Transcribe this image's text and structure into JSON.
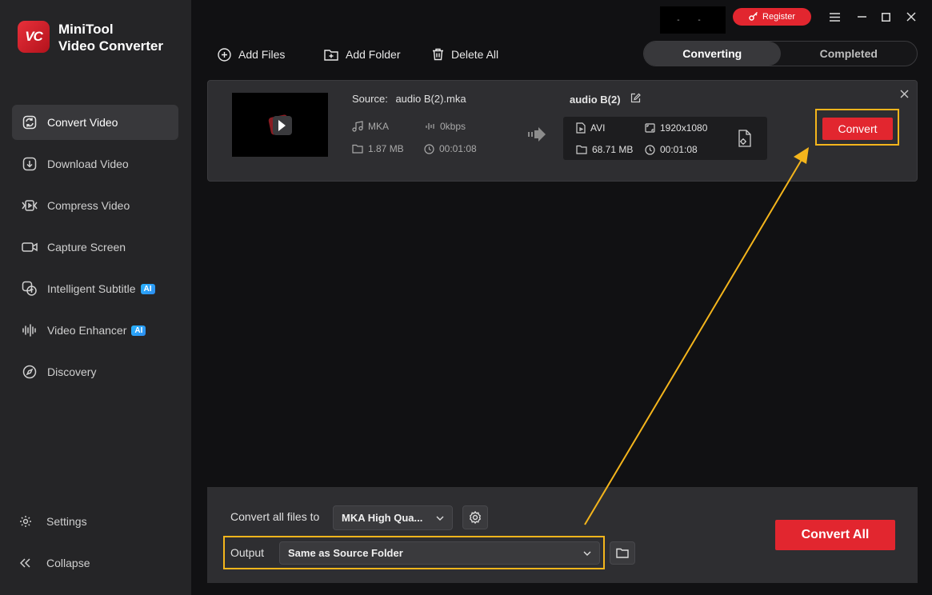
{
  "app": {
    "logo_text": "VC",
    "name_line1": "MiniTool",
    "name_line2": "Video Converter"
  },
  "sidebar": {
    "items": [
      {
        "label": "Convert Video",
        "icon": "convert-icon",
        "active": true,
        "ai": false
      },
      {
        "label": "Download Video",
        "icon": "download-icon",
        "active": false,
        "ai": false
      },
      {
        "label": "Compress Video",
        "icon": "compress-icon",
        "active": false,
        "ai": false
      },
      {
        "label": "Capture Screen",
        "icon": "camera-icon",
        "active": false,
        "ai": false
      },
      {
        "label": "Intelligent Subtitle",
        "icon": "subtitle-icon",
        "active": false,
        "ai": true
      },
      {
        "label": "Video Enhancer",
        "icon": "waveform-icon",
        "active": false,
        "ai": true
      },
      {
        "label": "Discovery",
        "icon": "compass-icon",
        "active": false,
        "ai": false
      }
    ],
    "ai_badge": "AI",
    "settings_label": "Settings",
    "collapse_label": "Collapse"
  },
  "titlebar": {
    "blank_text": "- -",
    "register_label": "Register"
  },
  "toolbar": {
    "add_files": "Add Files",
    "add_folder": "Add Folder",
    "delete_all": "Delete All"
  },
  "tabs": {
    "converting": "Converting",
    "completed": "Completed"
  },
  "task": {
    "source_label": "Source:",
    "source_name": "audio B(2).mka",
    "source_format": "MKA",
    "source_bitrate": "0kbps",
    "source_size": "1.87 MB",
    "source_duration": "00:01:08",
    "output_name": "audio B(2)",
    "output_format": "AVI",
    "output_resolution": "1920x1080",
    "output_size": "68.71 MB",
    "output_duration": "00:01:08",
    "convert_label": "Convert"
  },
  "bottom": {
    "convert_all_to_label": "Convert all files to",
    "format_value": "MKA High Qua...",
    "output_label": "Output",
    "output_value": "Same as Source Folder",
    "convert_all_label": "Convert All"
  },
  "colors": {
    "accent": "#e2262f",
    "highlight": "#f4b51c",
    "background": "#111113",
    "sidebar": "#252527"
  }
}
